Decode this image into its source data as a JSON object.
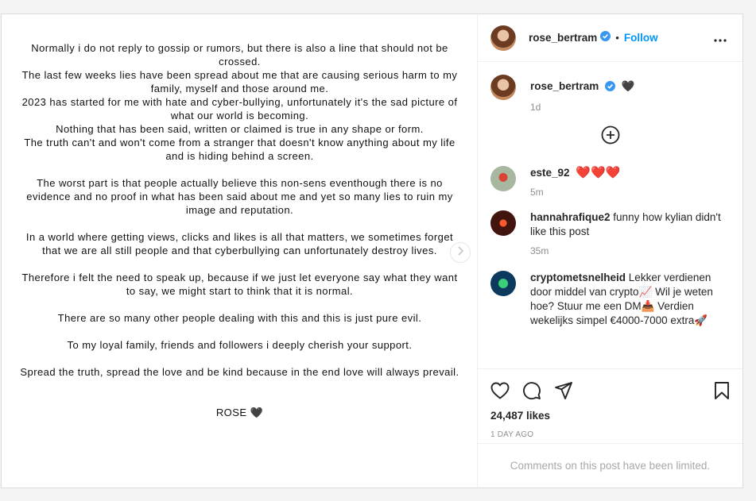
{
  "post": {
    "statement_paragraphs": [
      "Normally i do not reply to gossip or rumors, but there is also a line that should not be crossed.\nThe last few weeks lies have been spread about me that are causing serious harm to my family, myself and those around me.\n2023 has started for me with hate and cyber-bullying, unfortunately it's the sad picture of what our world is becoming.\nNothing that has been said, written or claimed is true in any shape or form.\nThe truth can't and won't come from a stranger that doesn't know anything about my life and is hiding behind a screen.",
      "The worst part is that people actually believe this non-sens eventhough there is no evidence and no proof in what has been said about me and yet so many lies to ruin my image and reputation.",
      "In a world where getting views, clicks and likes is all that matters, we sometimes forget that we are all still people and that cyberbullying can unfortunately destroy lives.",
      "Therefore i felt the need to speak up, because if we just let everyone say what they want to say, we might start to think that it is normal.",
      "There are so many other people dealing with this and this is just pure evil.",
      "To my loyal family, friends and followers i deeply cherish your support.",
      "Spread the truth, spread the love and be kind because in the end love will always prevail."
    ],
    "signature": "ROSE 🖤"
  },
  "header": {
    "username": "rose_bertram",
    "dot": "•",
    "follow_label": "Follow"
  },
  "caption": {
    "username": "rose_bertram",
    "text": "🖤",
    "time": "1d"
  },
  "comments": [
    {
      "username": "este_92",
      "text": "❤️❤️❤️",
      "time": "5m"
    },
    {
      "username": "hannahrafique2",
      "text": "funny how kylian didn't like this post",
      "time": "35m"
    },
    {
      "username": "cryptometsnelheid",
      "text": "Lekker verdienen door middel van crypto📈 Wil je weten hoe? Stuur me een DM📥 Verdien wekelijks simpel €4000-7000 extra🚀",
      "time": ""
    }
  ],
  "actions": {
    "likes": "24,487 likes",
    "time_ago": "1 DAY AGO"
  },
  "footer": {
    "limited_text": "Comments on this post have been limited."
  },
  "colors": {
    "accent": "#0095f6",
    "verified": "#3897f0",
    "muted": "#8e8e8e"
  },
  "icons": [
    "verified-badge-icon",
    "more-options-icon",
    "add-circle-icon",
    "chevron-right-icon",
    "heart-icon",
    "comment-icon",
    "share-icon",
    "bookmark-icon"
  ]
}
